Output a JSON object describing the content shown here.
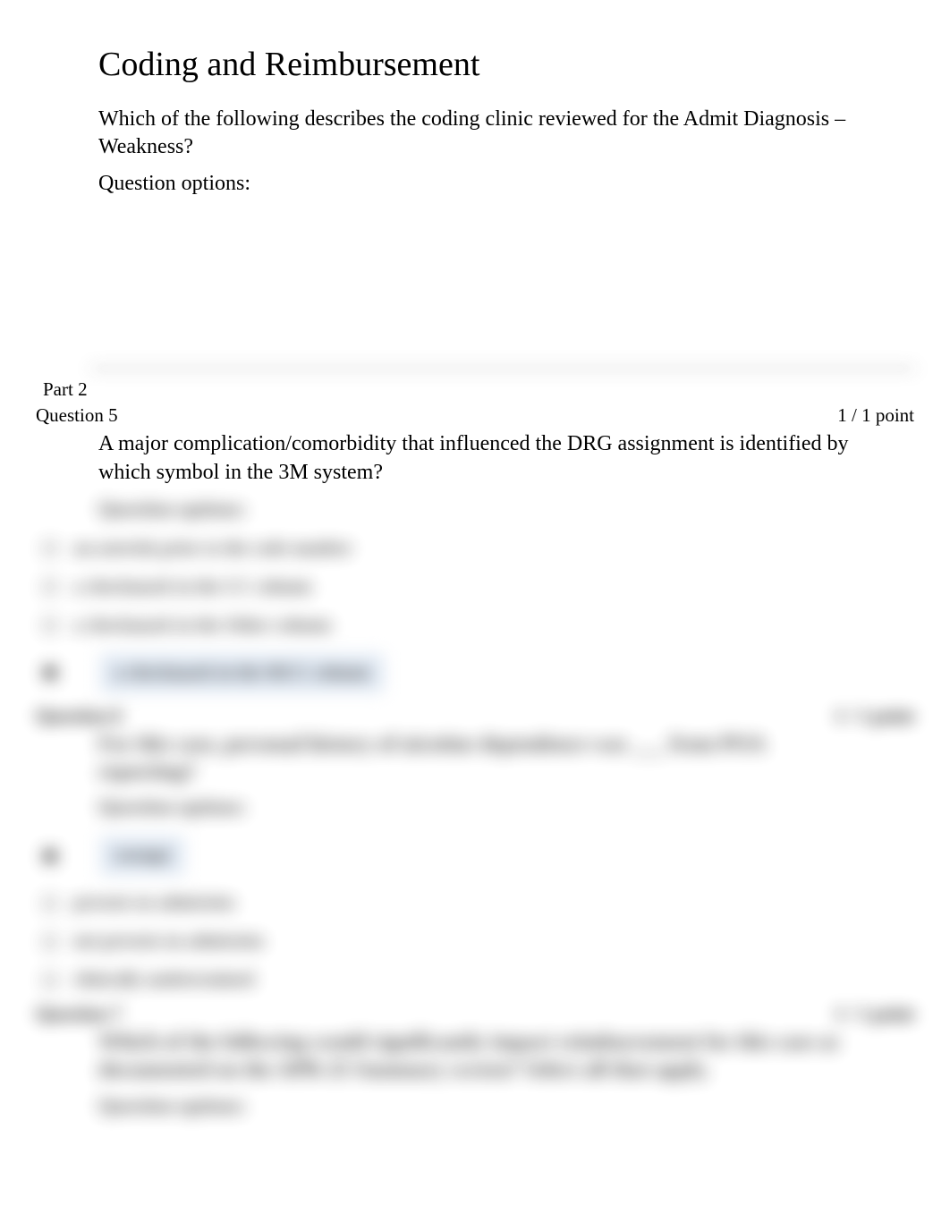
{
  "page_title": "Coding and Reimbursement",
  "intro_block": {
    "question_text": "Which of the following describes the coding clinic reviewed for the Admit Diagnosis – Weakness?",
    "options_label": "Question options:"
  },
  "section_label": "Part 2",
  "q5": {
    "header_left": "Question 5",
    "header_right": "1 / 1 point",
    "question_text": "A major complication/comorbidity that influenced the DRG assignment is identified by which symbol in the 3M system?",
    "options_label": "Question options:",
    "options": [
      "an asterisk prior to the code number",
      "a checkmark in the CC column",
      "a checkmark in the Other column",
      "a checkmark in the MCC column"
    ],
    "selected_index": 3
  },
  "q6": {
    "header_left": "Question 6",
    "header_right": "1 / 1 point",
    "question_text": "For this case, personal history of nicotine dependence was ___ from POA reporting?",
    "options_label": "Question options:",
    "options": [
      "exempt",
      "present on admission",
      "not present on admission",
      "clinically undetermined"
    ],
    "selected_index": 0
  },
  "q7": {
    "header_left": "Question 7",
    "header_right": "1 / 1 point",
    "question_text": "Which of the following would significantly impact reimbursement for this case as documented on the APR-25 Summary screen? Select all that apply.",
    "options_label": "Question options:"
  }
}
